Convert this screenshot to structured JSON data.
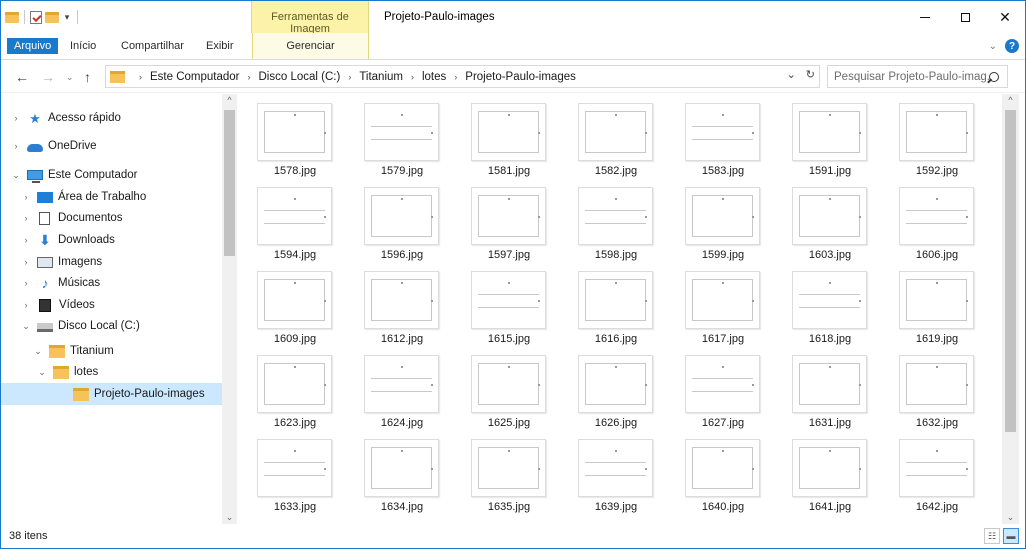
{
  "window": {
    "title": "Projeto-Paulo-images",
    "context_tab_header": "Ferramentas de Imagem",
    "close_glyph": "✕"
  },
  "ribbon": {
    "tabs": [
      "Arquivo",
      "Início",
      "Compartilhar",
      "Exibir"
    ],
    "context_tab": "Gerenciar",
    "accent": "#1979ca",
    "context_color": "#fcf3a8"
  },
  "address": {
    "crumbs": [
      "Este Computador",
      "Disco Local (C:)",
      "Titanium",
      "lotes",
      "Projeto-Paulo-images"
    ],
    "search_placeholder": "Pesquisar Projeto-Paulo-imag..."
  },
  "navpane": {
    "items": [
      {
        "label": "Acesso rápido",
        "icon": "star-icon",
        "expander": "›"
      },
      {
        "label": "OneDrive",
        "icon": "cloud-icon",
        "expander": "›"
      },
      {
        "label": "Este Computador",
        "icon": "computer-icon",
        "expander": "⌄"
      },
      {
        "label": "Área de Trabalho",
        "icon": "desktop-icon",
        "expander": "›"
      },
      {
        "label": "Documentos",
        "icon": "documents-icon",
        "expander": "›"
      },
      {
        "label": "Downloads",
        "icon": "downloads-icon",
        "expander": "›"
      },
      {
        "label": "Imagens",
        "icon": "pictures-icon",
        "expander": "›"
      },
      {
        "label": "Músicas",
        "icon": "music-icon",
        "expander": "›"
      },
      {
        "label": "Vídeos",
        "icon": "videos-icon",
        "expander": "›"
      },
      {
        "label": "Disco Local (C:)",
        "icon": "disk-icon",
        "expander": "⌄"
      },
      {
        "label": "Titanium",
        "icon": "folder-icon",
        "expander": "⌄"
      },
      {
        "label": "lotes",
        "icon": "folder-icon",
        "expander": "⌄"
      },
      {
        "label": "Projeto-Paulo-images",
        "icon": "folder-icon",
        "expander": ""
      }
    ],
    "selected": "Projeto-Paulo-images"
  },
  "files": [
    "1578.jpg",
    "1579.jpg",
    "1581.jpg",
    "1582.jpg",
    "1583.jpg",
    "1591.jpg",
    "1592.jpg",
    "1594.jpg",
    "1596.jpg",
    "1597.jpg",
    "1598.jpg",
    "1599.jpg",
    "1603.jpg",
    "1606.jpg",
    "1609.jpg",
    "1612.jpg",
    "1615.jpg",
    "1616.jpg",
    "1617.jpg",
    "1618.jpg",
    "1619.jpg",
    "1623.jpg",
    "1624.jpg",
    "1625.jpg",
    "1626.jpg",
    "1627.jpg",
    "1631.jpg",
    "1632.jpg",
    "1633.jpg",
    "1634.jpg",
    "1635.jpg",
    "1639.jpg",
    "1640.jpg",
    "1641.jpg",
    "1642.jpg"
  ],
  "status": {
    "item_count": "38 itens"
  }
}
